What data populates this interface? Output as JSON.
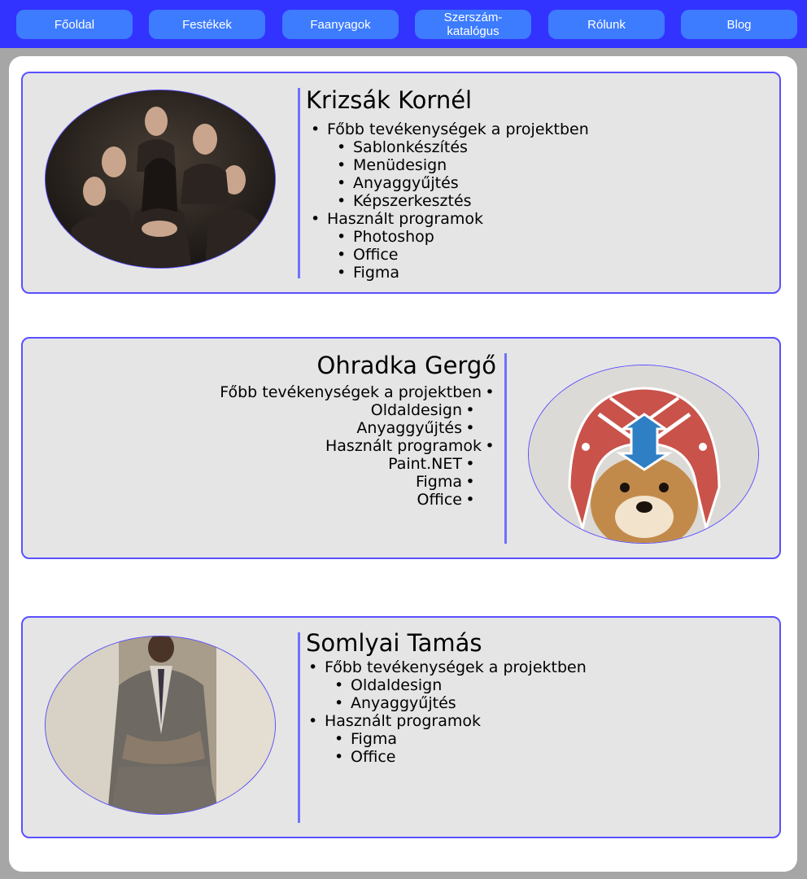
{
  "nav": {
    "items": [
      {
        "label": "Főoldal"
      },
      {
        "label": "Festékek"
      },
      {
        "label": "Faanyagok"
      },
      {
        "label": "Szerszám-\nkatalógus"
      },
      {
        "label": "Rólunk"
      },
      {
        "label": "Blog"
      }
    ]
  },
  "colors": {
    "nav_bg": "#3333ff",
    "nav_button": "#3d7cff",
    "page_bg": "#a6a6a6",
    "card_bg": "#e5e5e6",
    "card_border": "#5b50ff",
    "divider": "#7070ff"
  },
  "members": [
    {
      "name": "Krizsák Kornél",
      "activities_heading": "Főbb tevékenységek a projektben",
      "activities": [
        "Sablonkészítés",
        "Menüdesign",
        "Anyaggyűjtés",
        "Képszerkesztés"
      ],
      "programs_heading": "Használt programok",
      "programs": [
        "Photoshop",
        "Office",
        "Figma"
      ]
    },
    {
      "name": "Ohradka Gergő",
      "activities_heading": "Főbb tevékenységek a projektben",
      "activities": [
        "Oldaldesign",
        "Anyaggyűjtés"
      ],
      "programs_heading": "Használt programok",
      "programs": [
        "Paint.NET",
        "Figma",
        "Office"
      ]
    },
    {
      "name": "Somlyai Tamás",
      "activities_heading": "Főbb tevékenységek a projektben",
      "activities": [
        "Oldaldesign",
        "Anyaggyűjtés"
      ],
      "programs_heading": "Használt programok",
      "programs": [
        "Figma",
        "Office"
      ]
    }
  ]
}
